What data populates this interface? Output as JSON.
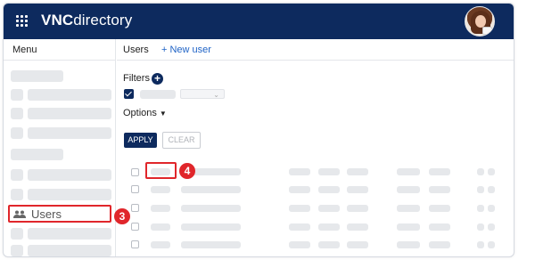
{
  "app": {
    "brand_bold": "VNC",
    "brand_light": "directory"
  },
  "sidebar": {
    "header": "Menu",
    "users_item": {
      "label": "Users",
      "icon": "users-icon",
      "annotation": "3"
    }
  },
  "main": {
    "tab_users": "Users",
    "new_user": "+ New user",
    "filters_label": "Filters",
    "add_filter_icon": "plus-circle-icon",
    "options_label": "Options",
    "apply_label": "APPLY",
    "clear_label": "CLEAR",
    "row_annotation": "4"
  },
  "colors": {
    "topbar": "#0d2a5e",
    "annotation_red": "#e0262b",
    "link_blue": "#1f63c6",
    "placeholder": "#e6e8eb"
  }
}
